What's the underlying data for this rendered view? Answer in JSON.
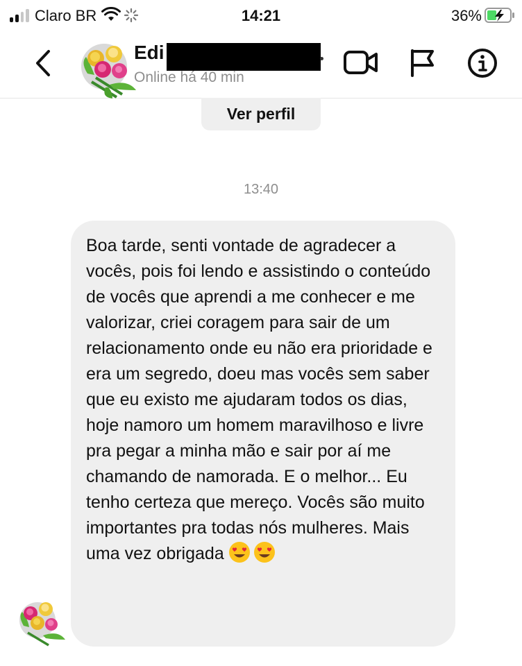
{
  "status_bar": {
    "carrier": "Claro BR",
    "time": "14:21",
    "battery_percent": "36%",
    "icons": [
      "signal-icon",
      "wifi-icon",
      "loading-icon",
      "battery-charging-icon"
    ]
  },
  "header": {
    "contact_name": "Edi",
    "online_status": "Online há 40 min",
    "icons": [
      "back-icon",
      "avatar",
      "video-call-icon",
      "flag-icon",
      "info-icon"
    ]
  },
  "profile_button": {
    "label": "Ver perfil"
  },
  "conversation": {
    "timestamp": "13:40",
    "message": "Boa tarde, senti vontade de agradecer a vocês, pois foi lendo e assistindo o conteúdo de vocês que aprendi a me conhecer e me valorizar, criei coragem para sair de um relacionamento onde eu não era prioridade e era um segredo, doeu mas vocês sem saber que eu existo me ajudaram todos os dias, hoje namoro um homem maravilhoso e livre pra pegar a minha mão e sair por aí me chamando de namorada. E o melhor... Eu tenho certeza que mereço. Vocês são muito importantes pra todas nós mulheres. Mais uma vez obrigada",
    "trailing_emojis": [
      "heart-eyes-emoji",
      "heart-eyes-emoji"
    ]
  },
  "colors": {
    "bubble": "#efefef",
    "secondary_text": "#8e8e8e",
    "primary_text": "#111111"
  }
}
